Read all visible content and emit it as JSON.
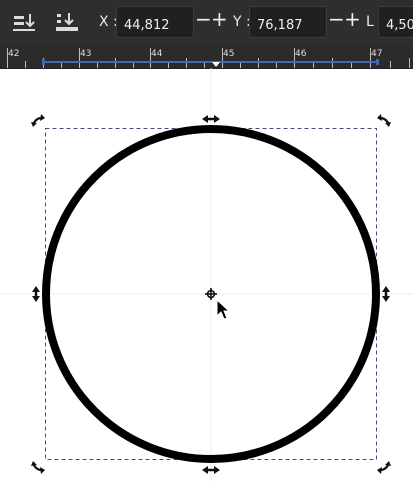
{
  "toolbar": {
    "x_label": "X :",
    "x_value": "44,812",
    "y_label": "Y :",
    "y_value": "76,187",
    "w_label": "L :",
    "w_value": "4,50",
    "minus": "−",
    "plus": "+",
    "icons": [
      "align-bottom-icon",
      "lower-to-bottom-icon"
    ]
  },
  "ruler": {
    "labels": [
      "42",
      "43",
      "44",
      "45",
      "46",
      "47"
    ]
  },
  "colors": {
    "toolbar_bg": "#2e2e2e",
    "ruler_bg": "#2b2b2b",
    "selection_line": "#3d6bb0",
    "canvas_bg": "#ffffff",
    "stroke": "#000000"
  }
}
